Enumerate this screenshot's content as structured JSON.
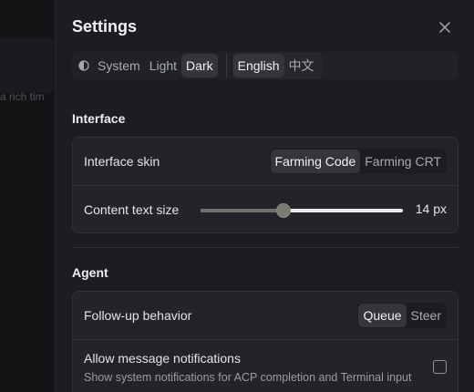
{
  "background": {
    "snippet": "a rich tim"
  },
  "panel": {
    "title": "Settings"
  },
  "topbar": {
    "theme_options": [
      "System",
      "Light",
      "Dark"
    ],
    "theme_selected": "Dark",
    "language_options": [
      "English",
      "中文"
    ],
    "language_selected": "English"
  },
  "interface": {
    "heading": "Interface",
    "skin": {
      "label": "Interface skin",
      "options": [
        "Farming Code",
        "Farming CRT"
      ],
      "selected": "Farming Code"
    },
    "text_size": {
      "label": "Content text size",
      "value": "14 px",
      "slider_fraction": 0.41
    }
  },
  "agent": {
    "heading": "Agent",
    "followup": {
      "label": "Follow-up behavior",
      "options": [
        "Queue",
        "Steer"
      ],
      "selected": "Queue"
    },
    "notifications": {
      "label": "Allow message notifications",
      "description": "Show system notifications for ACP completion and Terminal input",
      "checked": false
    }
  },
  "colors": {
    "panel_bg": "#1c1d20",
    "card_bg": "#232428",
    "accent_slider": "#6f7369"
  },
  "icons": {
    "close": "close-icon",
    "theme": "half-circle-theme-icon"
  }
}
